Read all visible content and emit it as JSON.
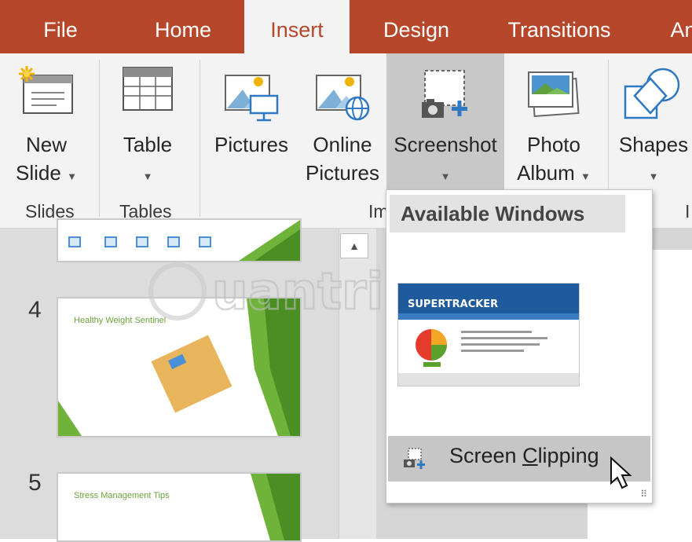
{
  "tabs": [
    {
      "label": "File",
      "active": false
    },
    {
      "label": "Home",
      "active": false
    },
    {
      "label": "Insert",
      "active": true
    },
    {
      "label": "Design",
      "active": false
    },
    {
      "label": "Transitions",
      "active": false
    },
    {
      "label": "An",
      "active": false
    }
  ],
  "ribbon": {
    "new_slide": {
      "line1": "New",
      "line2": "Slide"
    },
    "table": {
      "line1": "Table"
    },
    "pictures": {
      "line1": "Pictures"
    },
    "online_pictures": {
      "line1": "Online",
      "line2": "Pictures"
    },
    "screenshot": {
      "line1": "Screenshot"
    },
    "photo_album": {
      "line1": "Photo",
      "line2": "Album"
    },
    "shapes": {
      "line1": "Shapes"
    },
    "groups": {
      "slides": "Slides",
      "tables": "Tables",
      "images": "Im",
      "illustrations": "I"
    }
  },
  "slides": [
    {
      "number": "4",
      "title": "Healthy Weight Sentinel"
    },
    {
      "number": "5",
      "title": "Stress Management Tips"
    }
  ],
  "dropdown": {
    "header": "Available Windows",
    "window_title": "SUPERTRACKER",
    "clip_label_pre": "Screen ",
    "clip_label_accel": "C",
    "clip_label_post": "lipping"
  },
  "watermark_text": "uantrimang",
  "colors": {
    "accent": "#b7472a",
    "ribbon_bg": "#f3f3f3",
    "hover_bg": "#c8c8c8",
    "slide_green": "#6aa33c"
  },
  "icons": [
    "new-slide-icon",
    "table-icon",
    "pictures-icon",
    "online-pictures-icon",
    "screenshot-icon",
    "photo-album-icon",
    "shapes-icon",
    "screen-clipping-icon",
    "mouse-cursor-icon"
  ]
}
